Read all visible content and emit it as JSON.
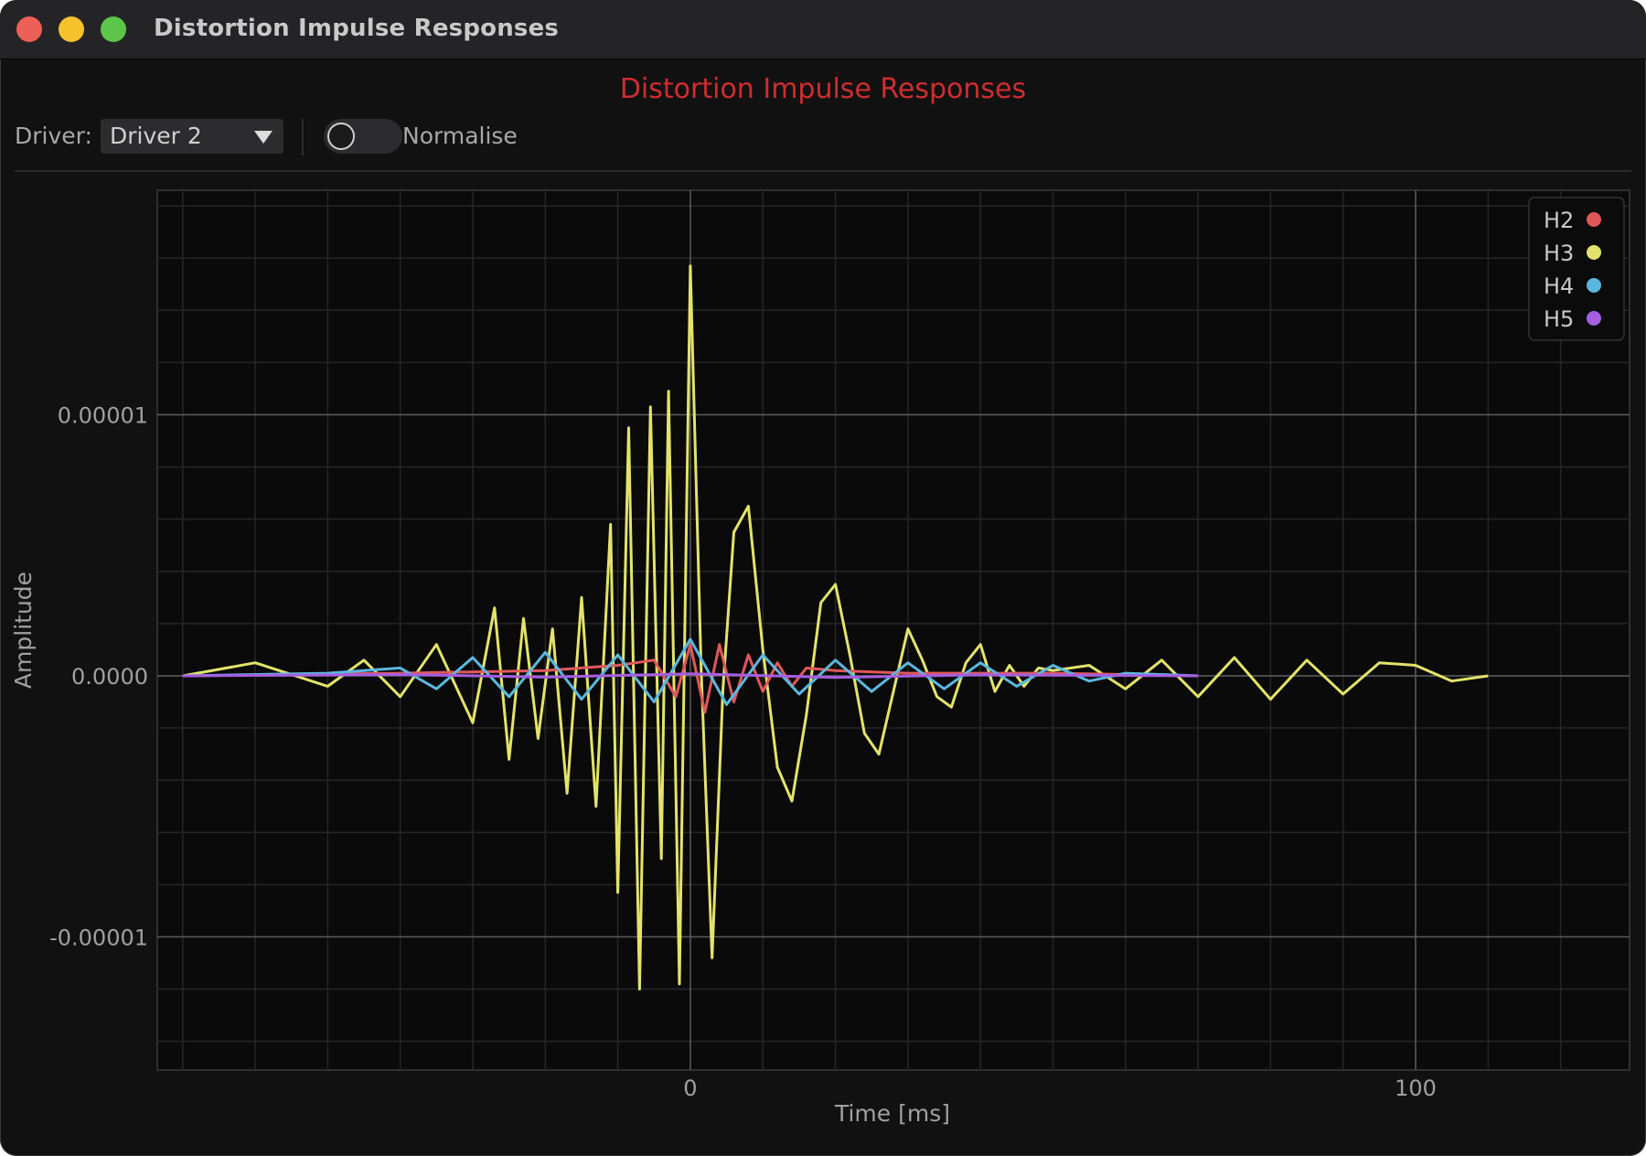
{
  "window": {
    "title": "Distortion Impulse Responses"
  },
  "app": {
    "title": "Distortion Impulse Responses"
  },
  "toolbar": {
    "driver_label": "Driver:",
    "driver_value": "Driver 2",
    "normalise_label": "Normalise",
    "normalise_on": false
  },
  "chart_data": {
    "type": "line",
    "title": "",
    "xlabel": "Time [ms]",
    "ylabel": "Amplitude",
    "xlim": [
      -73.5,
      129.5
    ],
    "ylim": [
      -1.51e-05,
      1.86e-05
    ],
    "x_ticks": [
      0,
      100
    ],
    "x_tick_labels": [
      "0",
      "100"
    ],
    "y_ticks": [
      1e-05,
      0,
      -1e-05
    ],
    "y_tick_labels": [
      "0.00001",
      "0.0000",
      "-0.00001"
    ],
    "grid": true,
    "legend_position": "top-right",
    "series": [
      {
        "name": "H2",
        "color": "#e0585a",
        "x": [
          -70,
          -40,
          -20,
          -10,
          -5,
          -2,
          0,
          2,
          4,
          6,
          8,
          10,
          12,
          14,
          16,
          20,
          30,
          50,
          70
        ],
        "y": [
          0,
          1e-07,
          2e-07,
          4e-07,
          6e-07,
          -8e-07,
          1.2e-06,
          -1.4e-06,
          1.2e-06,
          -1e-06,
          8e-07,
          -6e-07,
          5e-07,
          -4e-07,
          3e-07,
          2e-07,
          1e-07,
          1e-07,
          0
        ]
      },
      {
        "name": "H3",
        "color": "#e3e36b",
        "x": [
          -70,
          -60,
          -50,
          -45,
          -40,
          -35,
          -30,
          -27,
          -25,
          -23,
          -21,
          -19,
          -17,
          -15,
          -13,
          -11,
          -10,
          -8.5,
          -7,
          -5.5,
          -4,
          -3,
          -1.5,
          0,
          1.5,
          3,
          4.5,
          6,
          8,
          10,
          12,
          14,
          16,
          18,
          20,
          22,
          24,
          26,
          28,
          30,
          32,
          34,
          36,
          38,
          40,
          42,
          44,
          46,
          48,
          50,
          55,
          60,
          65,
          70,
          75,
          80,
          85,
          90,
          95,
          100,
          105,
          110
        ],
        "y": [
          0,
          5e-07,
          -4e-07,
          6e-07,
          -8e-07,
          1.2e-06,
          -1.8e-06,
          2.6e-06,
          -3.2e-06,
          2.2e-06,
          -2.4e-06,
          1.8e-06,
          -4.5e-06,
          3e-06,
          -5e-06,
          5.8e-06,
          -8.3e-06,
          9.5e-06,
          -1.2e-05,
          1.03e-05,
          -7e-06,
          1.09e-05,
          -1.18e-05,
          1.57e-05,
          2e-07,
          -1.08e-05,
          -5e-07,
          5.5e-06,
          6.5e-06,
          1e-06,
          -3.5e-06,
          -4.8e-06,
          -1.5e-06,
          2.8e-06,
          3.5e-06,
          8e-07,
          -2.2e-06,
          -3e-06,
          -6e-07,
          1.8e-06,
          6e-07,
          -8e-07,
          -1.2e-06,
          5e-07,
          1.2e-06,
          -6e-07,
          4e-07,
          -4e-07,
          3e-07,
          2e-07,
          4e-07,
          -5e-07,
          6e-07,
          -8e-07,
          7e-07,
          -9e-07,
          6e-07,
          -7e-07,
          5e-07,
          4e-07,
          -2e-07,
          0
        ]
      },
      {
        "name": "H4",
        "color": "#5ab8df",
        "x": [
          -70,
          -50,
          -40,
          -35,
          -30,
          -25,
          -20,
          -15,
          -10,
          -5,
          0,
          5,
          10,
          15,
          20,
          25,
          30,
          35,
          40,
          45,
          50,
          55,
          60,
          70
        ],
        "y": [
          0,
          1e-07,
          3e-07,
          -5e-07,
          7e-07,
          -8e-07,
          9e-07,
          -9e-07,
          8e-07,
          -1e-06,
          1.4e-06,
          -1.1e-06,
          8e-07,
          -7e-07,
          6e-07,
          -6e-07,
          5e-07,
          -5e-07,
          5e-07,
          -4e-07,
          4e-07,
          -2e-07,
          1e-07,
          0
        ]
      },
      {
        "name": "H5",
        "color": "#a55ee0",
        "x": [
          -70,
          -40,
          -20,
          0,
          20,
          40,
          70
        ],
        "y": [
          0,
          5e-08,
          -5e-08,
          8e-08,
          -6e-08,
          4e-08,
          0
        ]
      }
    ]
  }
}
